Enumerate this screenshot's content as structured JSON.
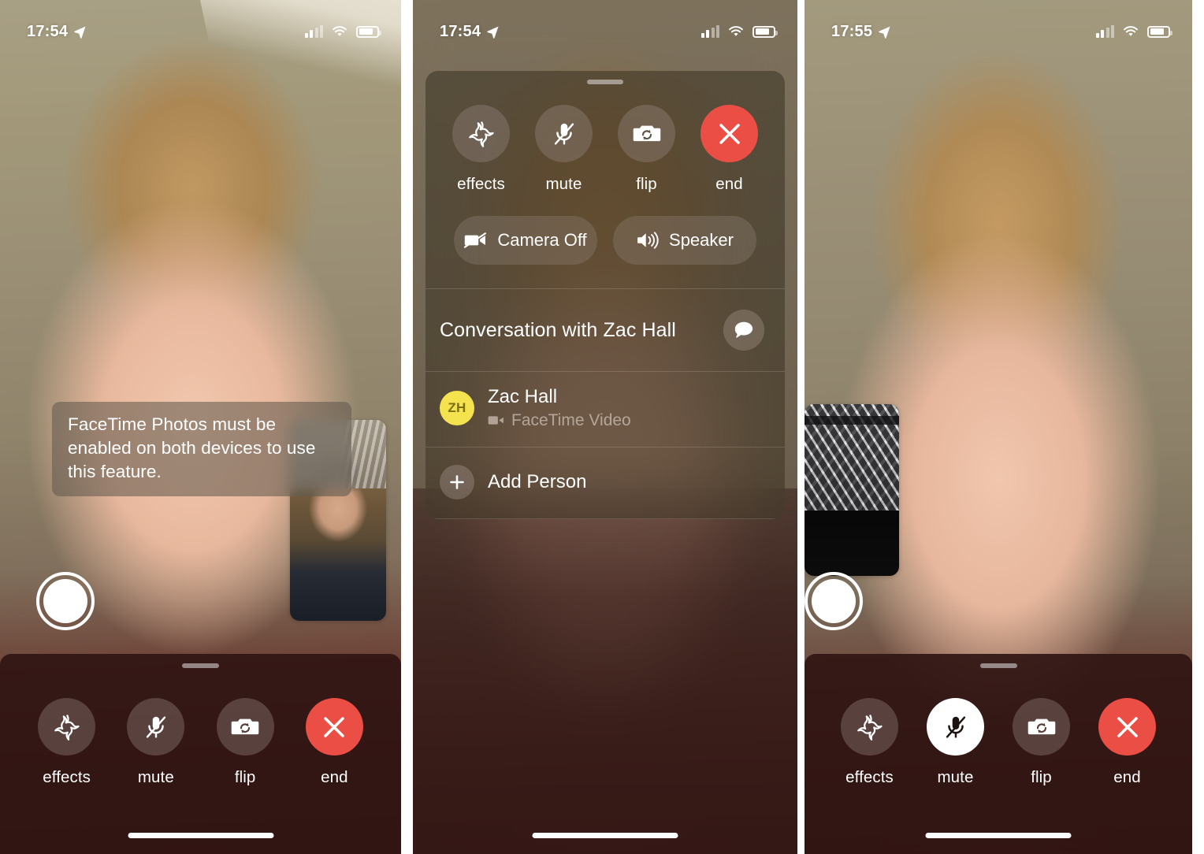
{
  "screens": [
    {
      "id": "screen-1",
      "status_bar": {
        "time": "17:54",
        "location_icon": "location-arrow-icon",
        "cellular_icon": "cellular-signal-icon",
        "wifi_icon": "wifi-icon",
        "battery_icon": "battery-icon"
      },
      "toast": {
        "text": "FaceTime Photos must be enabled on both devices to use this feature."
      },
      "shutter": {
        "name": "facetime-live-photo-shutter"
      },
      "pip": {
        "name": "self-view-thumbnail"
      },
      "controls": [
        {
          "label": "effects",
          "icon": "effects-star-icon",
          "state": "inactive"
        },
        {
          "label": "mute",
          "icon": "microphone-muted-icon",
          "state": "inactive"
        },
        {
          "label": "flip",
          "icon": "camera-flip-icon",
          "state": "inactive"
        },
        {
          "label": "end",
          "icon": "close-x-icon",
          "state": "danger"
        }
      ]
    },
    {
      "id": "screen-2",
      "status_bar": {
        "time": "17:54",
        "location_icon": "location-arrow-icon",
        "cellular_icon": "cellular-signal-icon",
        "wifi_icon": "wifi-icon",
        "battery_icon": "battery-icon"
      },
      "controls": [
        {
          "label": "effects",
          "icon": "effects-star-icon",
          "state": "inactive"
        },
        {
          "label": "mute",
          "icon": "microphone-muted-icon",
          "state": "inactive"
        },
        {
          "label": "flip",
          "icon": "camera-flip-icon",
          "state": "inactive"
        },
        {
          "label": "end",
          "icon": "close-x-icon",
          "state": "danger"
        }
      ],
      "pills": [
        {
          "label": "Camera Off",
          "icon": "video-off-icon"
        },
        {
          "label": "Speaker",
          "icon": "speaker-waves-icon"
        }
      ],
      "conversation": {
        "title": "Conversation with Zac Hall",
        "message_icon": "message-bubble-icon",
        "participants": [
          {
            "initials": "ZH",
            "name": "Zac Hall",
            "subtitle": "FaceTime Video",
            "subtitle_icon": "video-camera-icon"
          }
        ],
        "add_person": {
          "label": "Add Person",
          "icon": "plus-icon"
        }
      }
    },
    {
      "id": "screen-3",
      "status_bar": {
        "time": "17:55",
        "location_icon": "location-arrow-icon",
        "cellular_icon": "cellular-signal-icon",
        "wifi_icon": "wifi-icon",
        "battery_icon": "battery-icon"
      },
      "shutter": {
        "name": "facetime-live-photo-shutter"
      },
      "pip": {
        "name": "self-view-thumbnail"
      },
      "controls": [
        {
          "label": "effects",
          "icon": "effects-star-icon",
          "state": "inactive"
        },
        {
          "label": "mute",
          "icon": "microphone-muted-icon",
          "state": "active"
        },
        {
          "label": "flip",
          "icon": "camera-flip-icon",
          "state": "inactive"
        },
        {
          "label": "end",
          "icon": "close-x-icon",
          "state": "danger"
        }
      ]
    }
  ],
  "colors": {
    "danger_red": "#eb4e45",
    "avatar_yellow": "#f5e24f",
    "control_bar_bg": "#301513",
    "active_white": "#ffffff"
  }
}
